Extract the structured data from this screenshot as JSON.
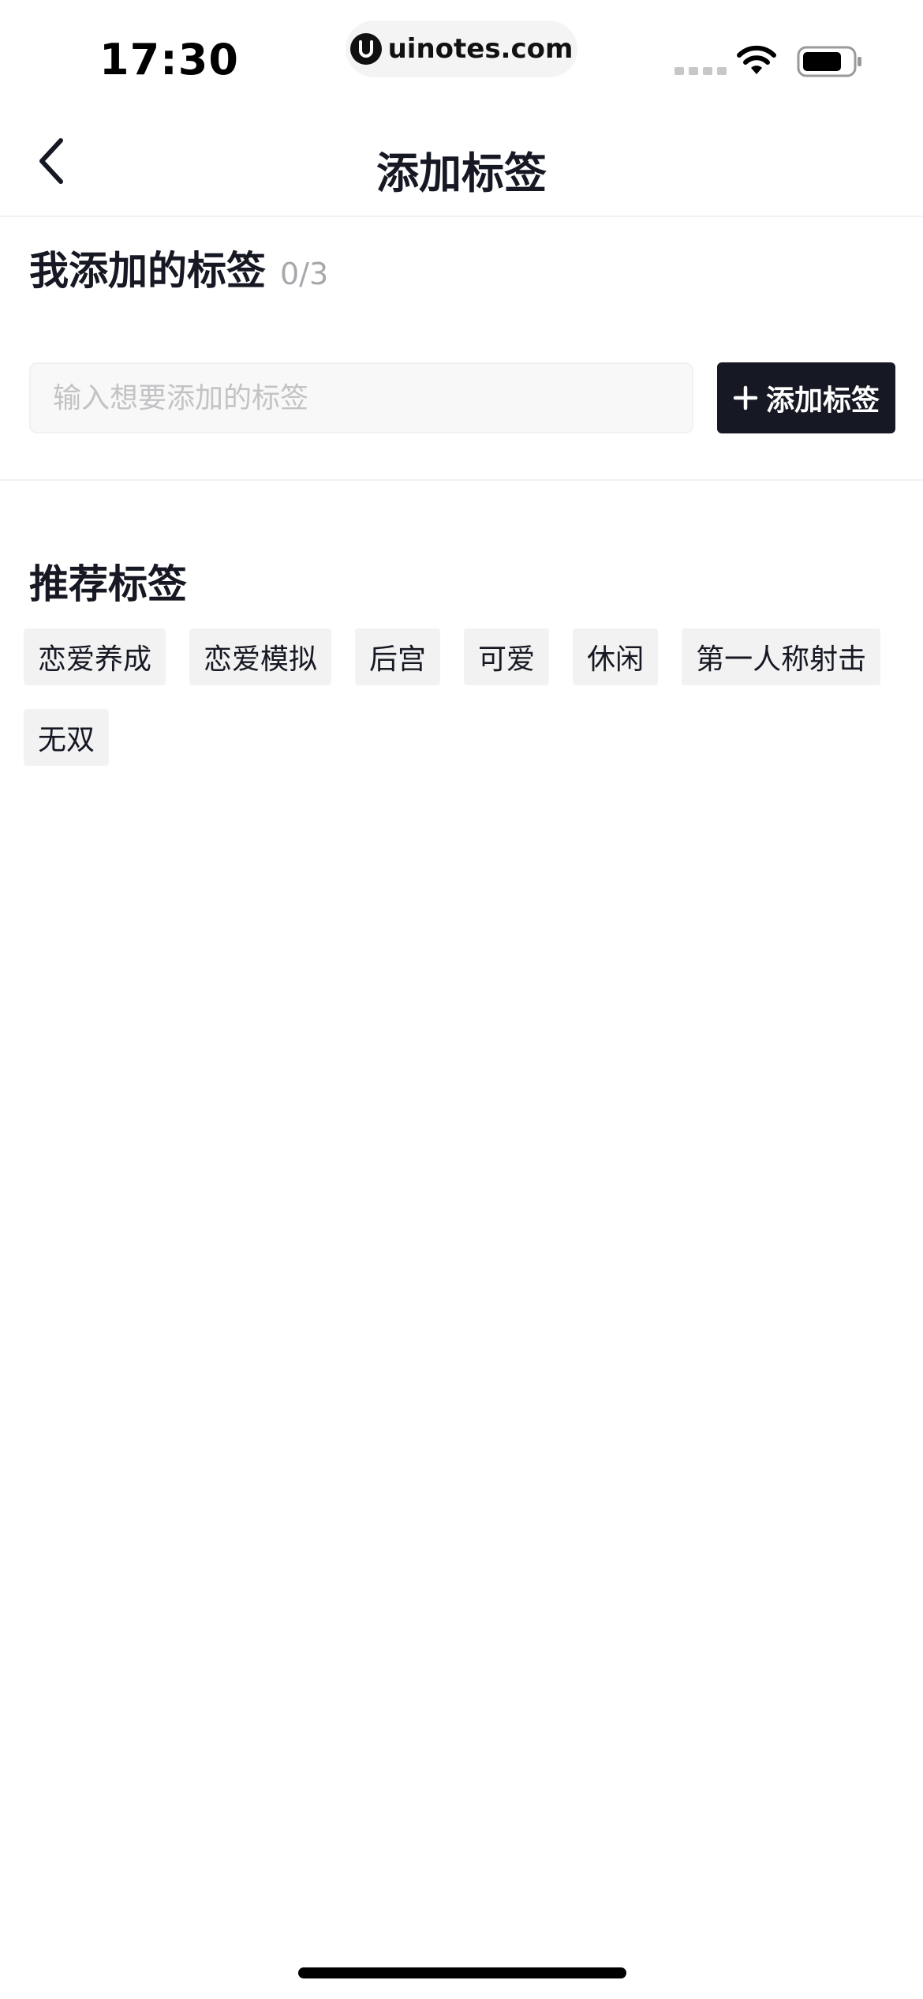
{
  "status_bar": {
    "time": "17:30",
    "url": "uinotes.com",
    "icons": [
      "signal-icon",
      "wifi-icon",
      "battery-icon"
    ]
  },
  "nav": {
    "title": "添加标签",
    "back_icon": "chevron-left-icon"
  },
  "my_tags": {
    "title": "我添加的标签",
    "count": "0/3",
    "input_placeholder": "输入想要添加的标签",
    "input_value": "",
    "add_button_label": "添加标签",
    "add_icon": "plus-icon"
  },
  "recommended": {
    "title": "推荐标签",
    "tags": [
      "恋爱养成",
      "恋爱模拟",
      "后宫",
      "可爱",
      "休闲",
      "第一人称射击",
      "无双"
    ]
  },
  "colors": {
    "primary_dark": "#161823",
    "chip_bg": "#f2f2f2",
    "muted_text": "#a7a8ac",
    "placeholder": "#c3c3c6"
  }
}
